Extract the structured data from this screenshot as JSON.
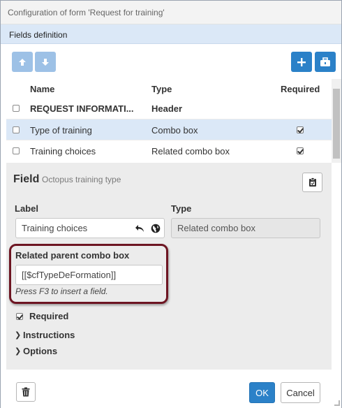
{
  "window": {
    "title": "Configuration of form 'Request for training'"
  },
  "section": {
    "label": "Fields definition"
  },
  "toolbar": {
    "move_up_icon": "arrow-up-icon",
    "move_down_icon": "arrow-down-icon",
    "add_icon": "plus-icon",
    "toolbox_icon": "toolbox-icon"
  },
  "grid": {
    "headers": {
      "name": "Name",
      "type": "Type",
      "required": "Required"
    },
    "rows": [
      {
        "name": "REQUEST INFORMATI...",
        "type": "Header",
        "required": false,
        "style": "header"
      },
      {
        "name": "Type of training",
        "type": "Combo box",
        "required": true,
        "style": "selected"
      },
      {
        "name": "Training choices",
        "type": "Related combo box",
        "required": true,
        "style": "normal"
      }
    ]
  },
  "field_panel": {
    "title": "Field",
    "subtitle": "Octopus training type",
    "label_caption": "Label",
    "label_value": "Training choices",
    "type_caption": "Type",
    "type_value": "Related combo box",
    "related_caption": "Related parent combo box",
    "related_value": "[[$cfTypeDeFormation]]",
    "hint": "Press F3 to insert a field.",
    "required_label": "Required",
    "required_checked": true,
    "instructions_label": "Instructions",
    "options_label": "Options"
  },
  "footer": {
    "ok_label": "OK",
    "cancel_label": "Cancel",
    "delete_icon": "trash-icon"
  },
  "colors": {
    "accent": "#2b81c8",
    "accent_light": "#9dc1e6",
    "section_bg": "#dbe8f7",
    "selected_row_bg": "#dbe8f7",
    "highlight_border": "#6d1522"
  }
}
